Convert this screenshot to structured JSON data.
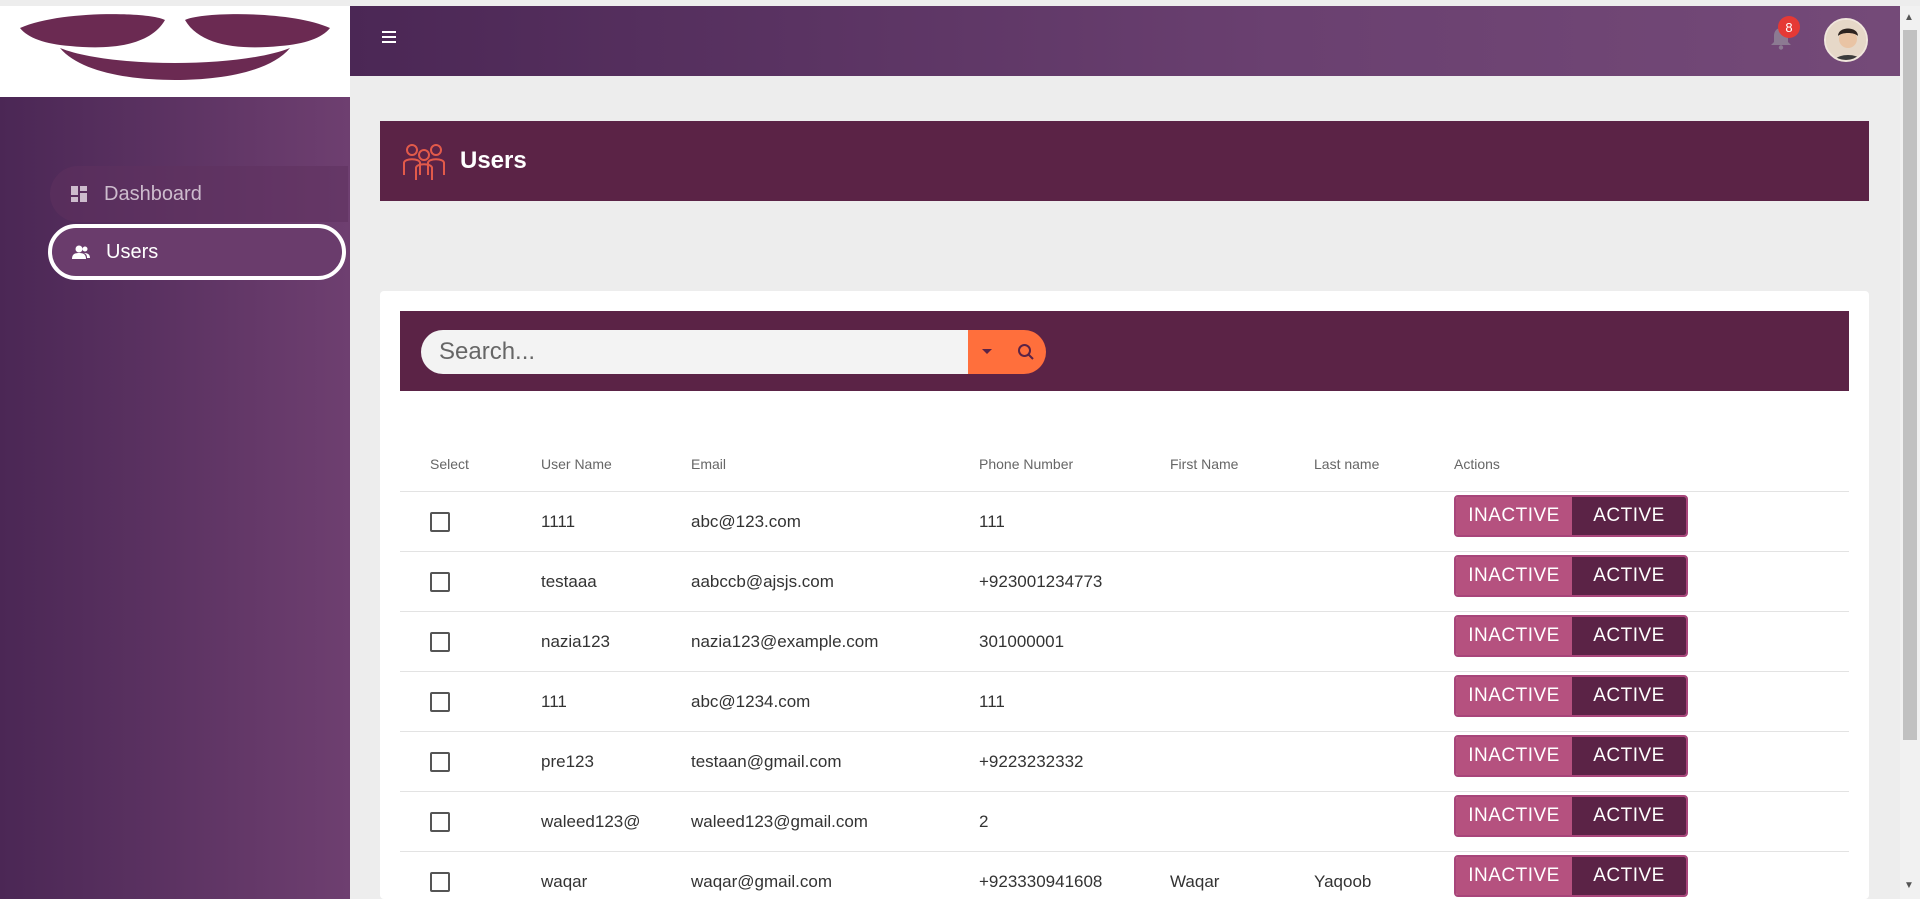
{
  "sidebar": {
    "items": [
      {
        "label": "Dashboard",
        "icon": "dashboard-icon"
      },
      {
        "label": "Users",
        "icon": "users-icon"
      }
    ]
  },
  "header": {
    "notification_count": "8"
  },
  "page": {
    "title": "Users"
  },
  "search": {
    "placeholder": "Search..."
  },
  "table": {
    "columns": [
      "Select",
      "User Name",
      "Email",
      "Phone Number",
      "First Name",
      "Last name",
      "Actions"
    ],
    "rows": [
      {
        "username": "1111",
        "email": "abc@123.com",
        "phone": "111",
        "first": "",
        "last": ""
      },
      {
        "username": "testaaa",
        "email": "aabccb@ajsjs.com",
        "phone": "+923001234773",
        "first": "",
        "last": ""
      },
      {
        "username": "nazia123",
        "email": "nazia123@example.com",
        "phone": "301000001",
        "first": "",
        "last": ""
      },
      {
        "username": "111",
        "email": "abc@1234.com",
        "phone": "111",
        "first": "",
        "last": ""
      },
      {
        "username": "pre123",
        "email": "testaan@gmail.com",
        "phone": "+9223232332",
        "first": "",
        "last": ""
      },
      {
        "username": "waleed123@",
        "email": "waleed123@gmail.com",
        "phone": "2",
        "first": "",
        "last": ""
      },
      {
        "username": "waqar",
        "email": "waqar@gmail.com",
        "phone": "+923330941608",
        "first": "Waqar",
        "last": "Yaqoob"
      }
    ],
    "inactive_label": "INACTIVE",
    "active_label": "ACTIVE"
  },
  "colors": {
    "primary": "#5b2346",
    "accent": "#ff6f3c",
    "toggle_inactive": "#b5517f",
    "badge": "#e53935"
  }
}
